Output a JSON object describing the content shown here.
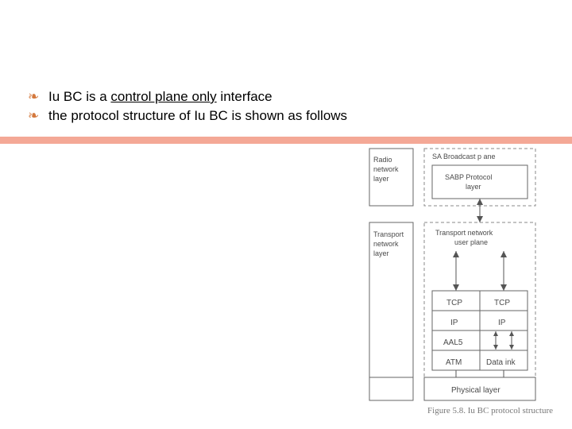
{
  "bullets": [
    {
      "pre": "Iu BC is a ",
      "u": "control plane only",
      "post": " interface"
    },
    {
      "pre": "the protocol structure of Iu BC is shown as follows",
      "u": "",
      "post": ""
    }
  ],
  "diagram": {
    "left_labels": {
      "radio": "Radio\nnetwork\nlayer",
      "transport": "Transport\nnetwork\nlayer"
    },
    "sa_header": "SA Broadcast p ane",
    "sabp": "SABP Protocol\nlayer",
    "tn_user": "Transport network\nuser plane",
    "stack_left": [
      "TCP",
      "IP",
      "AAL5",
      "ATM"
    ],
    "stack_right": [
      "TCP",
      "IP",
      "",
      "Data ink"
    ],
    "phys": "Physical layer"
  },
  "caption": "Figure 5.8.  Iu BC protocol structure"
}
